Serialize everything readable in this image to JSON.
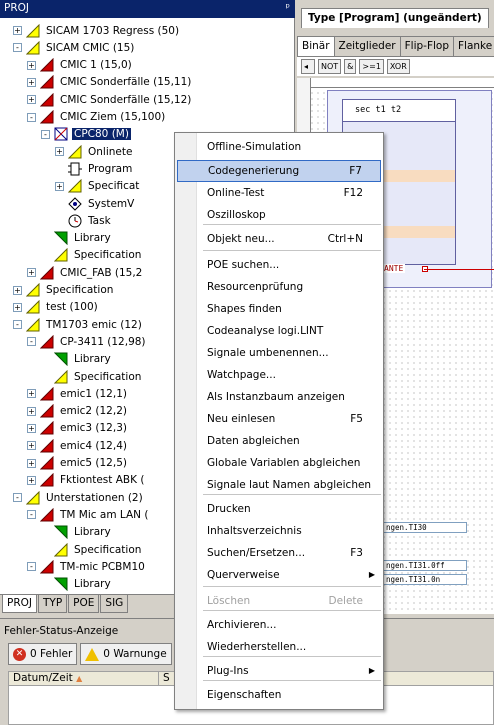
{
  "left_panel": {
    "title": "PROJ",
    "pin_glyph": "ᵖ",
    "tabs": [
      "PROJ",
      "TYP",
      "POE",
      "SIG"
    ],
    "tree": [
      {
        "label": "SICAM 1703 Regress (50)",
        "icon": "yellow-triangle-icon",
        "exp": "+"
      },
      {
        "label": "SICAM CMIC (15)",
        "icon": "yellow-triangle-icon",
        "exp": "-"
      },
      {
        "label": "CMIC 1 (15,0)",
        "icon": "red-triangle-icon",
        "exp": "+"
      },
      {
        "label": "CMIC Sonderfälle (15,11)",
        "icon": "red-triangle-icon",
        "exp": "+"
      },
      {
        "label": "CMIC Sonderfälle (15,12)",
        "icon": "red-triangle-icon",
        "exp": "+"
      },
      {
        "label": "CMIC Ziem (15,100)",
        "icon": "red-triangle-icon",
        "exp": "-"
      },
      {
        "label": "CPC80 (M)",
        "icon": "cpu-module-icon",
        "exp": "-"
      },
      {
        "label": "Onlinete",
        "icon": "yellow-triangle-icon",
        "exp": "+"
      },
      {
        "label": "Program",
        "icon": "program-icon",
        "exp": ""
      },
      {
        "label": "Specificat",
        "icon": "yellow-triangle-icon",
        "exp": "+"
      },
      {
        "label": "SystemV",
        "icon": "system-icon",
        "exp": ""
      },
      {
        "label": "Task",
        "icon": "clock-icon",
        "exp": ""
      },
      {
        "label": "Library",
        "icon": "green-triangle-icon",
        "exp": ""
      },
      {
        "label": "Specification",
        "icon": "yellow-triangle-icon",
        "exp": ""
      },
      {
        "label": "CMIC_FAB (15,2",
        "icon": "red-triangle-icon",
        "exp": "+"
      },
      {
        "label": "Specification",
        "icon": "yellow-triangle-icon",
        "exp": "+"
      },
      {
        "label": "test (100)",
        "icon": "yellow-triangle-icon",
        "exp": "+"
      },
      {
        "label": "TM1703 emic (12)",
        "icon": "yellow-triangle-icon",
        "exp": "-"
      },
      {
        "label": "CP-3411 (12,98)",
        "icon": "red-triangle-icon",
        "exp": "-"
      },
      {
        "label": "Library",
        "icon": "green-triangle-icon",
        "exp": ""
      },
      {
        "label": "Specification",
        "icon": "yellow-triangle-icon",
        "exp": ""
      },
      {
        "label": "emic1 (12,1)",
        "icon": "red-triangle-icon",
        "exp": "+"
      },
      {
        "label": "emic2 (12,2)",
        "icon": "red-triangle-icon",
        "exp": "+"
      },
      {
        "label": "emic3 (12,3)",
        "icon": "red-triangle-icon",
        "exp": "+"
      },
      {
        "label": "emic4 (12,4)",
        "icon": "red-triangle-icon",
        "exp": "+"
      },
      {
        "label": "emic5 (12,5)",
        "icon": "red-triangle-icon",
        "exp": "+"
      },
      {
        "label": "Fktiontest ABK (",
        "icon": "red-triangle-icon",
        "exp": "+"
      },
      {
        "label": "Unterstationen (2)",
        "icon": "yellow-triangle-icon",
        "exp": "-"
      },
      {
        "label": "TM Mic am LAN (",
        "icon": "red-triangle-icon",
        "exp": "-"
      },
      {
        "label": "Library",
        "icon": "green-triangle-icon",
        "exp": ""
      },
      {
        "label": "Specification",
        "icon": "yellow-triangle-icon",
        "exp": ""
      },
      {
        "label": "TM-mic PCBM10",
        "icon": "red-triangle-icon",
        "exp": "-"
      },
      {
        "label": "Library",
        "icon": "green-triangle-icon",
        "exp": ""
      },
      {
        "label": "Specification",
        "icon": "yellow-triangle-icon",
        "exp": ""
      }
    ]
  },
  "editor": {
    "title": "Type [Program] (ungeändert)",
    "tabs": [
      "Binär",
      "Zeitglieder",
      "Flip-Flop",
      "Flanke"
    ],
    "palette": [
      "NOT",
      "&",
      ">=1",
      "XOR"
    ],
    "block_header": "sec t1  t2",
    "var_label": "ANTE",
    "signals": [
      "ngen.TI30",
      "ngen.TI31.0ff",
      "ngen.TI31.0n"
    ]
  },
  "error_pane": {
    "title": "Fehler-Status-Anzeige",
    "errors_btn": "0 Fehler",
    "warnings_btn": "0 Warnunge",
    "col_date": "Datum/Zeit",
    "col_second": "S"
  },
  "context_menu": {
    "items": [
      {
        "label": "Offline-Simulation",
        "shortcut": "",
        "highlight": false,
        "disabled": false,
        "submenu": false
      },
      {
        "label": "Codegenerierung",
        "shortcut": "F7",
        "highlight": true,
        "disabled": false,
        "submenu": false
      },
      {
        "label": "Online-Test",
        "shortcut": "F12",
        "highlight": false,
        "disabled": false,
        "submenu": false
      },
      {
        "label": "Oszilloskop",
        "shortcut": "",
        "highlight": false,
        "disabled": false,
        "submenu": false
      },
      {
        "label": "Objekt neu...",
        "shortcut": "Ctrl+N",
        "highlight": false,
        "disabled": false,
        "submenu": false
      },
      {
        "label": "POE suchen...",
        "shortcut": "",
        "highlight": false,
        "disabled": false,
        "submenu": false
      },
      {
        "label": "Resourcenprüfung",
        "shortcut": "",
        "highlight": false,
        "disabled": false,
        "submenu": false
      },
      {
        "label": "Shapes finden",
        "shortcut": "",
        "highlight": false,
        "disabled": false,
        "submenu": false
      },
      {
        "label": "Codeanalyse logi.LINT",
        "shortcut": "",
        "highlight": false,
        "disabled": false,
        "submenu": false
      },
      {
        "label": "Signale umbenennen...",
        "shortcut": "",
        "highlight": false,
        "disabled": false,
        "submenu": false
      },
      {
        "label": "Watchpage...",
        "shortcut": "",
        "highlight": false,
        "disabled": false,
        "submenu": false
      },
      {
        "label": "Als Instanzbaum anzeigen",
        "shortcut": "",
        "highlight": false,
        "disabled": false,
        "submenu": false
      },
      {
        "label": "Neu einlesen",
        "shortcut": "F5",
        "highlight": false,
        "disabled": false,
        "submenu": false
      },
      {
        "label": "Daten abgleichen",
        "shortcut": "",
        "highlight": false,
        "disabled": false,
        "submenu": false
      },
      {
        "label": "Globale Variablen abgleichen",
        "shortcut": "",
        "highlight": false,
        "disabled": false,
        "submenu": false
      },
      {
        "label": "Signale laut Namen abgleichen",
        "shortcut": "",
        "highlight": false,
        "disabled": false,
        "submenu": false
      },
      {
        "label": "Drucken",
        "shortcut": "",
        "highlight": false,
        "disabled": false,
        "submenu": false
      },
      {
        "label": "Inhaltsverzeichnis",
        "shortcut": "",
        "highlight": false,
        "disabled": false,
        "submenu": false
      },
      {
        "label": "Suchen/Ersetzen...",
        "shortcut": "F3",
        "highlight": false,
        "disabled": false,
        "submenu": false
      },
      {
        "label": "Querverweise",
        "shortcut": "",
        "highlight": false,
        "disabled": false,
        "submenu": true
      },
      {
        "label": "Löschen",
        "shortcut": "Delete",
        "highlight": false,
        "disabled": true,
        "submenu": false
      },
      {
        "label": "Archivieren...",
        "shortcut": "",
        "highlight": false,
        "disabled": false,
        "submenu": false
      },
      {
        "label": "Wiederherstellen...",
        "shortcut": "",
        "highlight": false,
        "disabled": false,
        "submenu": false
      },
      {
        "label": "Plug-Ins",
        "shortcut": "",
        "highlight": false,
        "disabled": false,
        "submenu": true
      },
      {
        "label": "Eigenschaften",
        "shortcut": "",
        "highlight": false,
        "disabled": false,
        "submenu": false
      }
    ]
  },
  "colors": {
    "selection": "#0a246a",
    "menu_highlight": "#c1d2ee",
    "triangle_yellow": "#ffff00",
    "triangle_red": "#cc0000",
    "triangle_green": "#00a000"
  }
}
